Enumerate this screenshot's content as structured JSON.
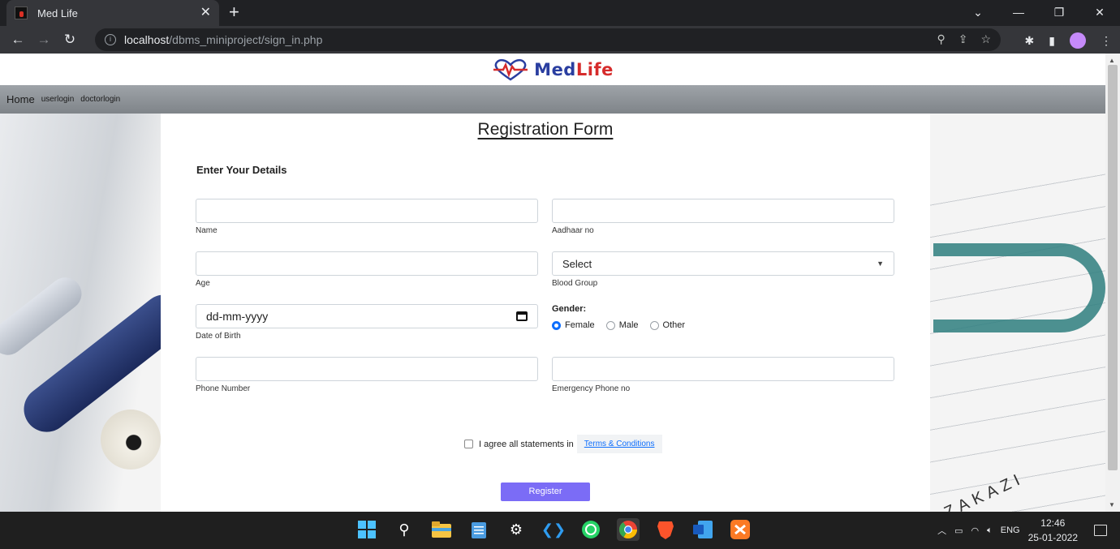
{
  "browser": {
    "tab_title": "Med Life",
    "tab_close": "✕",
    "new_tab": "+",
    "url_host": "localhost",
    "url_path": "/dbms_miniproject/sign_in.php"
  },
  "site": {
    "logo_text_a": "Med",
    "logo_text_b": "Life",
    "nav": {
      "home": "Home",
      "userlogin": "userlogin",
      "doctorlogin": "doctorlogin"
    }
  },
  "form": {
    "title": "Registration Form",
    "subhead": "Enter Your Details",
    "name_label": "Name",
    "aadhaar_label": "Aadhaar no",
    "age_label": "Age",
    "blood_value": "Select",
    "blood_label": "Blood Group",
    "dob_value": "dd-mm-yyyy",
    "dob_label": "Date of Birth",
    "gender_label": "Gender:",
    "gender_options": [
      "Female",
      "Male",
      "Other"
    ],
    "gender_selected": "Female",
    "phone_label": "Phone Number",
    "emergency_label": "Emergency Phone no",
    "agree_text": "I agree all statements in",
    "terms_link": "Terms & Conditions",
    "register_label": "Register"
  },
  "background": {
    "watermark_text": "ZAKAZI"
  },
  "taskbar": {
    "language": "ENG",
    "time": "12:46",
    "date": "25-01-2022"
  }
}
